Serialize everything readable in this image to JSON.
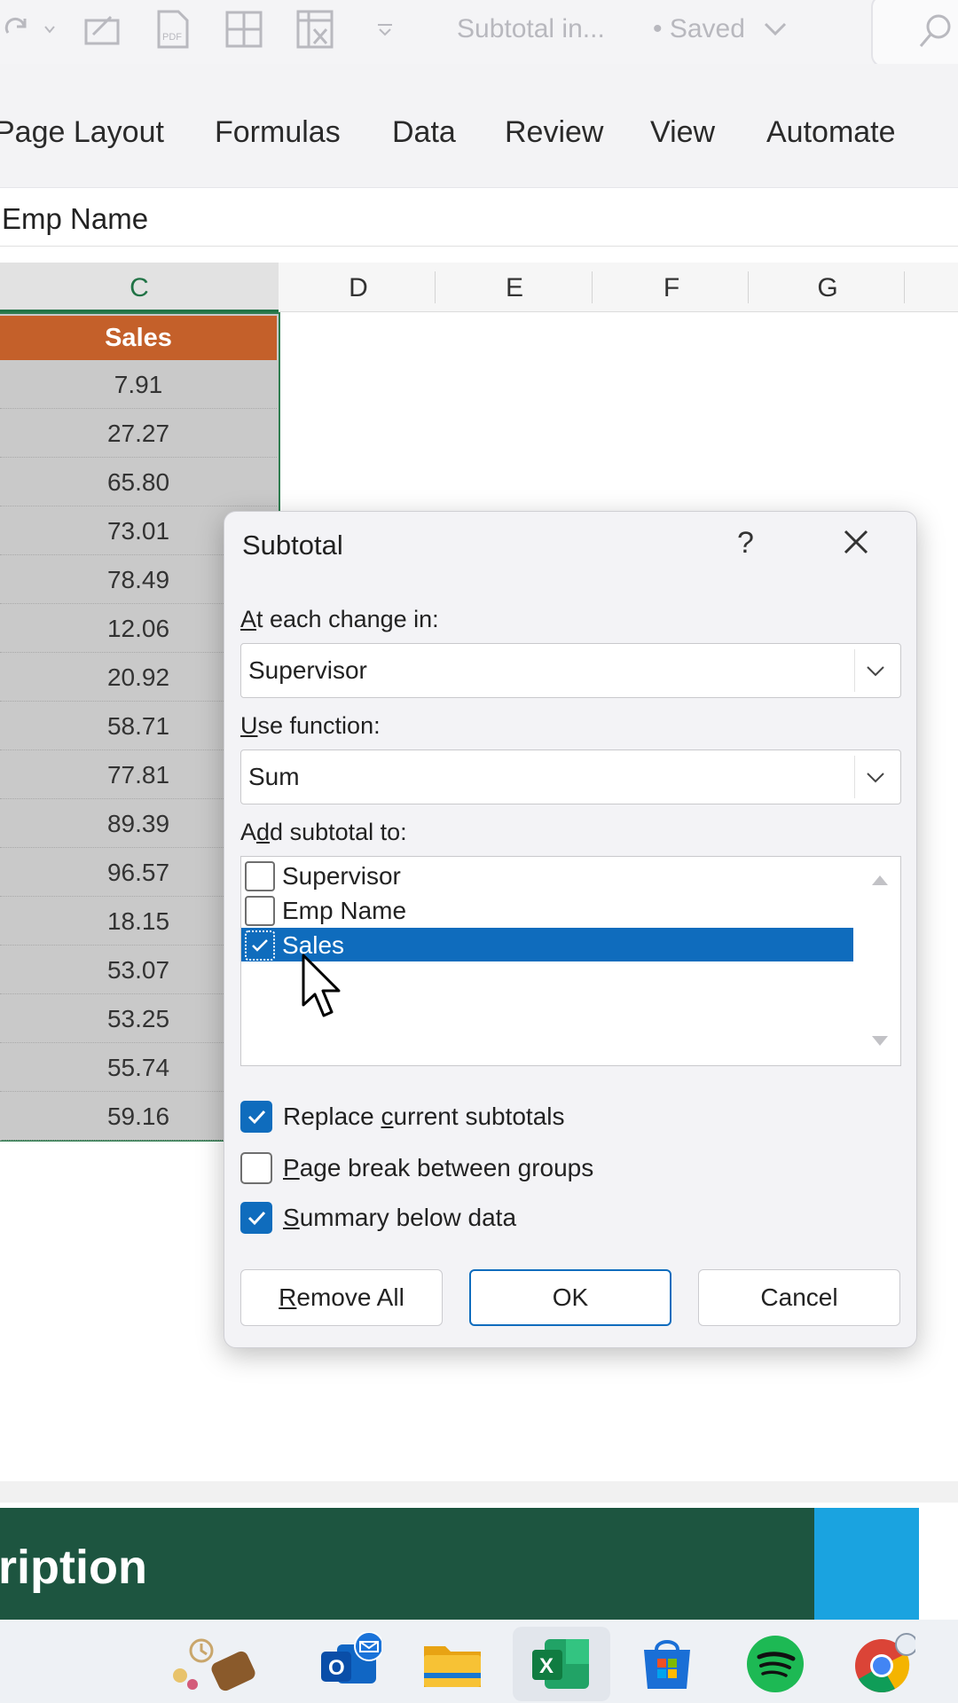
{
  "quick_access": {
    "doc_title": "Subtotal in...",
    "saved_status": "• Saved"
  },
  "ribbon": {
    "tabs": [
      "Page Layout",
      "Formulas",
      "Data",
      "Review",
      "View",
      "Automate"
    ]
  },
  "formula_bar": {
    "value": "Emp Name"
  },
  "columns": [
    "C",
    "D",
    "E",
    "F",
    "G"
  ],
  "sheet": {
    "header": "Sales",
    "sales": [
      "7.91",
      "27.27",
      "65.80",
      "73.01",
      "78.49",
      "12.06",
      "20.92",
      "58.71",
      "77.81",
      "89.39",
      "96.57",
      "18.15",
      "53.07",
      "53.25",
      "55.74",
      "59.16"
    ]
  },
  "dialog": {
    "title": "Subtotal",
    "help": "?",
    "change_label_u": "A",
    "change_label_rest": "t each change in:",
    "change_value": "Supervisor",
    "function_label_u": "U",
    "function_label_rest": "se function:",
    "function_value": "Sum",
    "add_label_pre": "A",
    "add_label_u": "d",
    "add_label_rest": "d subtotal to:",
    "fields": [
      {
        "label": "Supervisor",
        "checked": false
      },
      {
        "label": "Emp Name",
        "checked": false
      },
      {
        "label": "Sales",
        "checked": true
      }
    ],
    "options": {
      "replace_pre": "Replace ",
      "replace_u": "c",
      "replace_rest": "urrent subtotals",
      "pagebreak_u": "P",
      "pagebreak_rest": "age break between groups",
      "summary_u": "S",
      "summary_rest": "ummary below data"
    },
    "buttons": {
      "remove_u": "R",
      "remove_rest": "emove All",
      "ok": "OK",
      "cancel": "Cancel"
    }
  },
  "banner": {
    "text": "ription"
  },
  "colors": {
    "header_orange": "#c4602a",
    "accent_blue": "#0f6cbd",
    "banner_green": "#1d5540",
    "banner_cyan": "#1aa3e0"
  }
}
